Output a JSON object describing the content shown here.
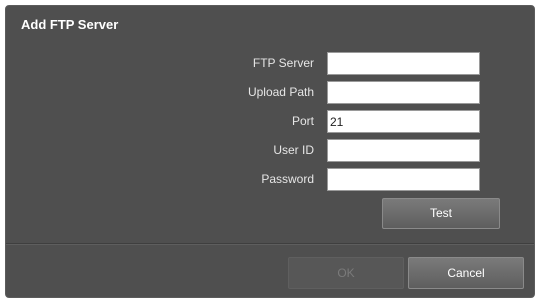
{
  "dialog": {
    "title": "Add FTP Server"
  },
  "form": {
    "ftp_server_label": "FTP Server",
    "ftp_server_value": "",
    "upload_path_label": "Upload Path",
    "upload_path_value": "",
    "port_label": "Port",
    "port_value": "21",
    "user_id_label": "User ID",
    "user_id_value": "",
    "password_label": "Password",
    "password_value": ""
  },
  "buttons": {
    "test": "Test",
    "ok": "OK",
    "cancel": "Cancel"
  },
  "colors": {
    "dialog_background": "#4f4f4f",
    "button_background": "#6b6b6b",
    "disabled_text": "#7a7a7a"
  }
}
